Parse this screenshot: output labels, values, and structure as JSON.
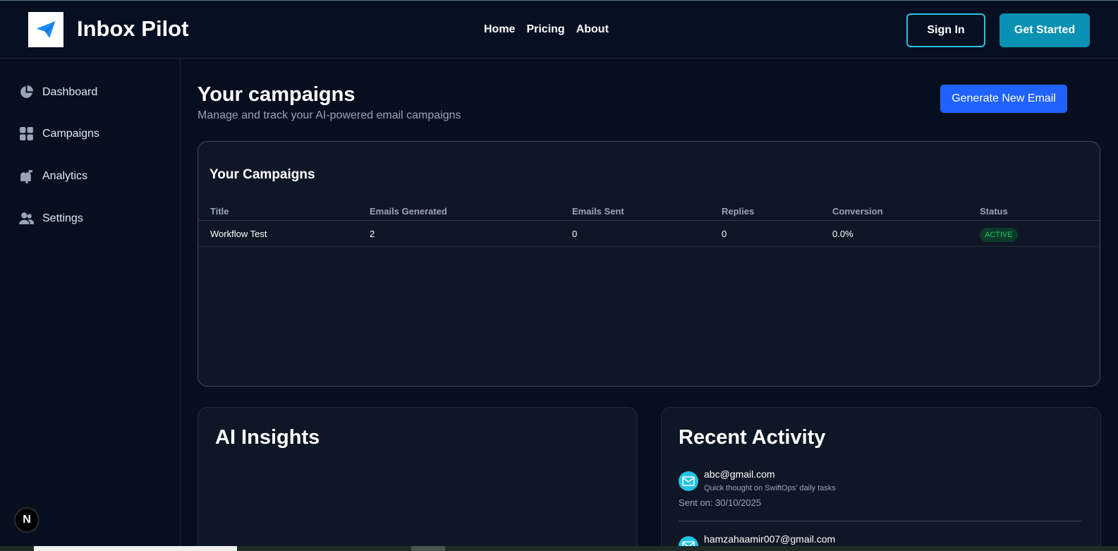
{
  "header": {
    "brand": "Inbox Pilot",
    "logo_icon": "paper-plane-icon",
    "nav": [
      "Home",
      "Pricing",
      "About"
    ],
    "sign_in": "Sign In",
    "get_started": "Get Started"
  },
  "sidebar": {
    "items": [
      {
        "label": "Dashboard",
        "icon": "pie-chart-icon"
      },
      {
        "label": "Campaigns",
        "icon": "grid-icon"
      },
      {
        "label": "Analytics",
        "icon": "mailbox-icon"
      },
      {
        "label": "Settings",
        "icon": "users-icon"
      }
    ],
    "badge": "N"
  },
  "main": {
    "title": "Your campaigns",
    "subtitle": "Manage and track your AI-powered email campaigns",
    "generate_button": "Generate New Email",
    "campaigns_card": {
      "title": "Your Campaigns",
      "columns": [
        "Title",
        "Emails Generated",
        "Emails Sent",
        "Replies",
        "Conversion",
        "Status"
      ],
      "rows": [
        {
          "title": "Workflow Test",
          "generated": "2",
          "sent": "0",
          "replies": "0",
          "conversion": "0.0%",
          "status": "ACTIVE"
        }
      ]
    },
    "insights": {
      "title": "AI Insights"
    },
    "activity": {
      "title": "Recent Activity",
      "items": [
        {
          "email": "abc@gmail.com",
          "subject": "Quick thought on SwiftOps' daily tasks",
          "sent": "Sent on: 30/10/2025"
        },
        {
          "email": "hamzahaamir007@gmail.com"
        }
      ]
    }
  },
  "colors": {
    "accent_cyan": "#22c3e6",
    "primary_blue": "#1f62ff",
    "active_green": "#22c55e"
  }
}
